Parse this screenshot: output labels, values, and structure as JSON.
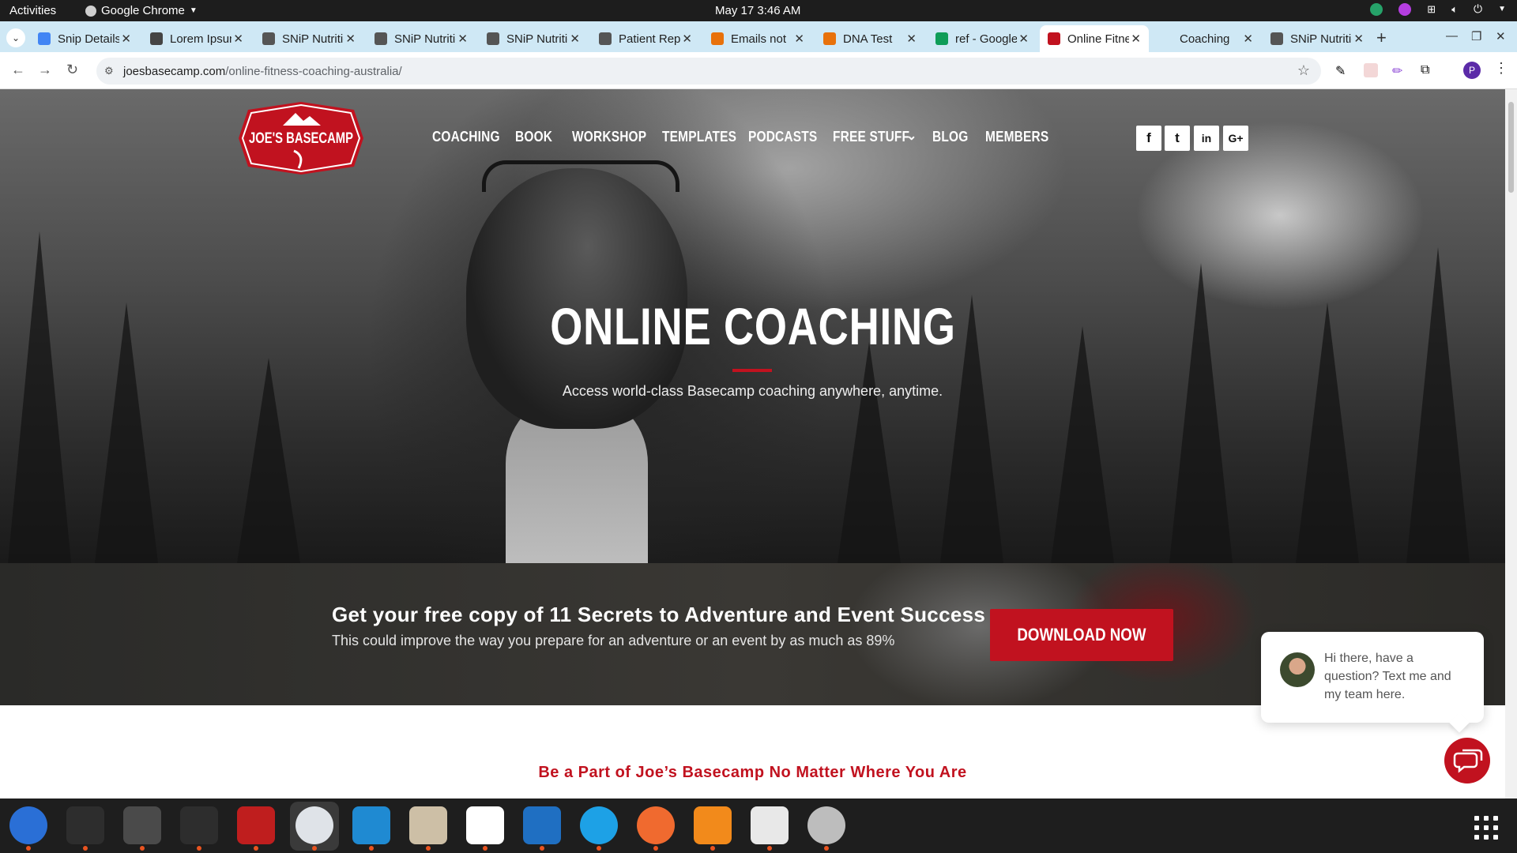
{
  "system": {
    "activities": "Activities",
    "app_name": "Google Chrome",
    "clock": "May 17  3:46 AM"
  },
  "tabs": [
    {
      "title": "Snip Details",
      "favicon_color": "#4285f4"
    },
    {
      "title": "Lorem Ipsum",
      "favicon_color": "#444444"
    },
    {
      "title": "SNiP Nutrition",
      "favicon_color": "#555555"
    },
    {
      "title": "SNiP Nutrition",
      "favicon_color": "#555555"
    },
    {
      "title": "SNiP Nutrition",
      "favicon_color": "#555555"
    },
    {
      "title": "Patient Report",
      "favicon_color": "#555555"
    },
    {
      "title": "Emails not",
      "favicon_color": "#e8710a"
    },
    {
      "title": "DNA Test",
      "favicon_color": "#e8710a"
    },
    {
      "title": "ref - Google",
      "favicon_color": "#0f9d58"
    },
    {
      "title": "Online Fitness",
      "favicon_color": "#c1121f",
      "active": true
    },
    {
      "title": "Coaching",
      "favicon_color": "#cfe8f5"
    },
    {
      "title": "SNiP Nutrition",
      "favicon_color": "#555555"
    }
  ],
  "address_bar": {
    "host": "joesbasecamp.com",
    "path": "/online-fitness-coaching-australia/"
  },
  "site": {
    "logo_text": "JOE'S BASECAMP",
    "nav": [
      "COACHING",
      "BOOK",
      "WORKSHOP",
      "TEMPLATES",
      "PODCASTS",
      "FREE STUFF",
      "BLOG",
      "MEMBERS"
    ],
    "social": [
      "f",
      "t",
      "in",
      "G+"
    ],
    "hero_title": "ONLINE COACHING",
    "hero_subtitle": "Access world-class Basecamp coaching anywhere, anytime.",
    "band_title": "Get your free copy of 11 Secrets to Adventure and Event Success",
    "band_subtitle": "This could improve the way you prepare for an adventure or an event by as much as 89%",
    "download_label": "DOWNLOAD NOW",
    "section_heading": "Be a Part of Joe’s Basecamp No Matter Where You Are",
    "chat_message": "Hi there, have a question? Text me and my team here.",
    "accent_color": "#c1121f"
  },
  "dock": [
    {
      "name": "thunderbird-icon",
      "color": "#2a6fd6"
    },
    {
      "name": "terminal-icon",
      "color": "#2d2d2d"
    },
    {
      "name": "calculator-icon",
      "color": "#4a4a4a"
    },
    {
      "name": "system-monitor-icon",
      "color": "#2d2d2d"
    },
    {
      "name": "filezilla-icon",
      "color": "#bf1e1e"
    },
    {
      "name": "chrome-icon",
      "color": "#dfe3e8"
    },
    {
      "name": "vscode-icon",
      "color": "#1f8ad2"
    },
    {
      "name": "files-icon",
      "color": "#cdbfa6"
    },
    {
      "name": "text-editor-icon",
      "color": "#ffffff"
    },
    {
      "name": "writer-icon",
      "color": "#1f6fc2"
    },
    {
      "name": "skype-icon",
      "color": "#1da1e6"
    },
    {
      "name": "pencil-app-icon",
      "color": "#f06a2f"
    },
    {
      "name": "firefox-dev-icon",
      "color": "#f28a1b"
    },
    {
      "name": "document-viewer-icon",
      "color": "#e8e8e8"
    },
    {
      "name": "disk-icon",
      "color": "#bdbdbd"
    }
  ]
}
